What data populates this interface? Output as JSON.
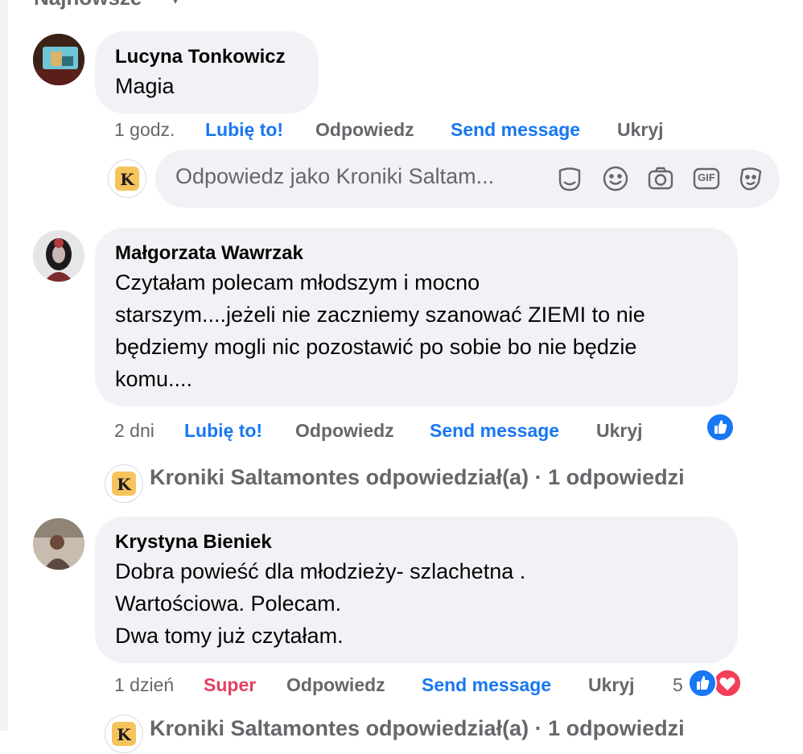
{
  "header": {
    "sort_label": "Najnowsze",
    "sort_chevron": "chevron-down-icon"
  },
  "colors": {
    "link": "#1877f2",
    "muted": "#65676b",
    "bubble": "#f0f2f5",
    "super": "#e4405f",
    "love": "#f33e58",
    "brand": "#f6c45c"
  },
  "comments": [
    {
      "author": "Lucyna Tonkowicz",
      "text": "Magia",
      "time": "1 godz.",
      "reaction_label": "Lubię to!",
      "reply_label": "Odpowiedz",
      "send_label": "Send message",
      "hide_label": "Ukryj"
    },
    {
      "author": "Małgorzata Wawrzak",
      "text": "Czytałam polecam młodszym i mocno\nstarszym....jeżeli nie zaczniemy szanować ZIEMI to nie\nbędziemy mogli nic pozostawić po sobie bo nie będzie\nkomu....",
      "time": "2 dni",
      "reaction_label": "Lubię to!",
      "reply_label": "Odpowiedz",
      "send_label": "Send message",
      "hide_label": "Ukryj",
      "reactions": [
        "like"
      ]
    },
    {
      "author": "Krystyna Bieniek",
      "text": "Dobra powieść dla młodzieży- szlachetna .\nWartościowa. Polecam.\nDwa tomy już czytałam.",
      "time": "1 dzień",
      "reaction_label": "Super",
      "reply_label": "Odpowiedz",
      "send_label": "Send message",
      "hide_label": "Ukryj",
      "reaction_count": "5",
      "reactions": [
        "like",
        "love"
      ]
    }
  ],
  "reply_box": {
    "placeholder": "Odpowiedz jako Kroniki Saltam...",
    "page_logo_letter": "K",
    "tools": [
      "sticker-icon",
      "emoji-icon",
      "camera-icon",
      "gif-icon",
      "avatar-sticker-icon"
    ],
    "gif_text": "GIF"
  },
  "thread": {
    "text": "Kroniki Saltamontes odpowiedział(a)",
    "separator": "·",
    "count": "1 odpowiedzi"
  }
}
